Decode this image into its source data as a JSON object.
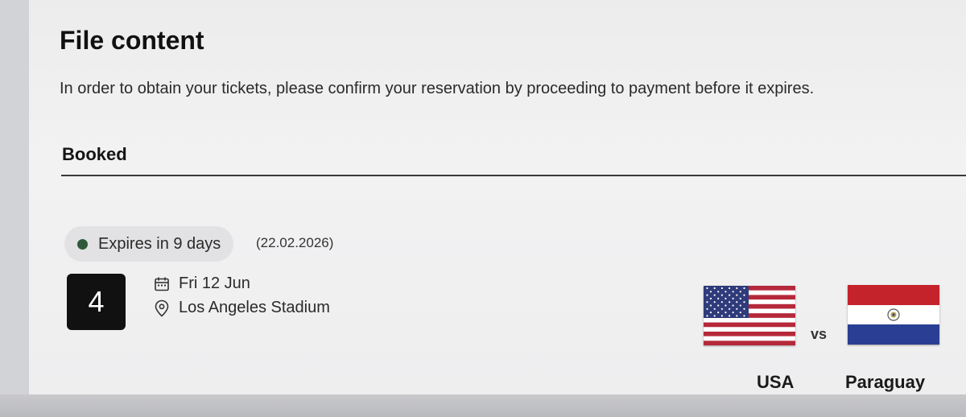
{
  "page": {
    "title": "File content",
    "description": "In order to obtain your tickets, please confirm your reservation by proceeding to payment before it expires."
  },
  "booked": {
    "section_title": "Booked",
    "status": {
      "label": "Expires in 9 days",
      "date": "(22.02.2026)",
      "dot_color": "#2f5a3a"
    },
    "match": {
      "number": "4",
      "date": "Fri 12 Jun",
      "date_icon": "calendar-icon",
      "venue": "Los Angeles Stadium",
      "venue_icon": "location-pin-icon",
      "home_team": "USA",
      "home_flag": "usa-flag",
      "vs_label": "vs",
      "away_team": "Paraguay",
      "away_flag": "paraguay-flag"
    }
  }
}
